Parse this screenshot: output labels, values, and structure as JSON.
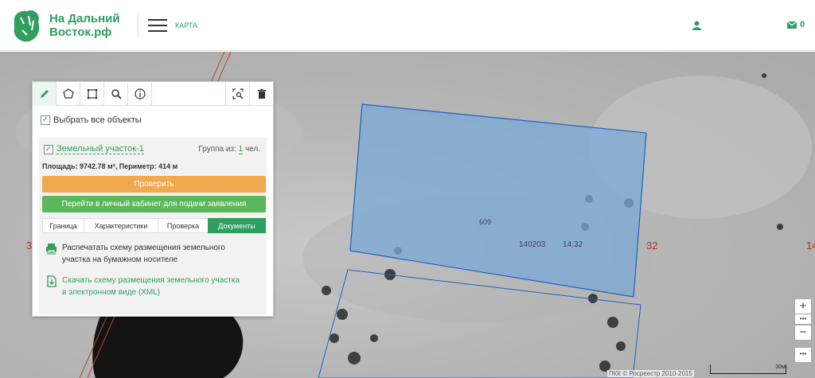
{
  "header": {
    "brand_line1": "На Дальний",
    "brand_line2": "Восток.рф",
    "nav_map": "КАРТА",
    "mail_count": "0"
  },
  "colors": {
    "brand_green": "#2f9e5e",
    "orange_button": "#f0a94c",
    "green_button": "#5cb85c",
    "parcel_fill": "#7aa9d6",
    "parcel_stroke": "#2060c0"
  },
  "toolbar": {
    "tools": [
      "pencil-icon",
      "polygon-icon",
      "rectangle-icon",
      "search-icon",
      "info-icon"
    ],
    "right_tools": [
      "zoom-to-icon",
      "trash-icon"
    ]
  },
  "panel": {
    "select_all": "Выбрать все объекты",
    "parcel_name": "Земельный участок-1",
    "group_prefix": "Группа из:",
    "group_count": "1",
    "group_suffix": "чел.",
    "area_text": "Площадь: 9742.78 м², Периметр: 414 м",
    "check_button": "Проверить",
    "cabinet_button": "Перейти в личный кабинет для подачи заявления",
    "tabs": [
      "Граница",
      "Характеристики",
      "Проверка",
      "Документы"
    ],
    "active_tab": "Документы",
    "doc_print_line1": "Распечатать схему размещения земельного",
    "doc_print_line2": "участка на бумажном носителе",
    "doc_download_line1": "Скачать схему размещения земельного участка",
    "doc_download_line2": "в электронном виде (XML)"
  },
  "map": {
    "parcel_number": "609",
    "quarter_number": "140203",
    "cadastral_suffix": "14:32",
    "label_left": "3",
    "label_32": "32",
    "label_right": "14",
    "zoom_in": "+",
    "more": "•••",
    "zoom_out": "−",
    "copyright": "ПКК © Росреестр 2010-2015",
    "scale_label": "30м"
  }
}
